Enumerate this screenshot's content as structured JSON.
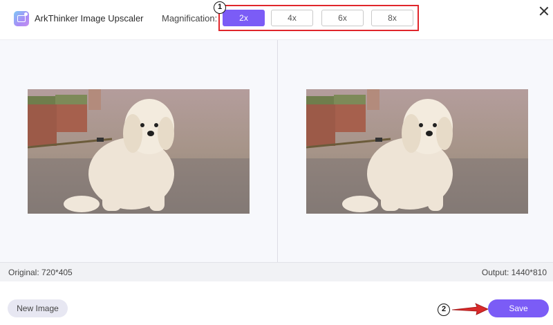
{
  "app": {
    "title": "ArkThinker Image Upscaler",
    "logo_icon": "image-upscaler-logo-icon"
  },
  "magnification": {
    "label": "Magnification:",
    "options": [
      {
        "label": "2x",
        "selected": true
      },
      {
        "label": "4x",
        "selected": false
      },
      {
        "label": "6x",
        "selected": false
      },
      {
        "label": "8x",
        "selected": false
      }
    ]
  },
  "annotations": {
    "step1": "1",
    "step2": "2"
  },
  "footer": {
    "original": "Original: 720*405",
    "output": "Output: 1440*810",
    "new_image": "New Image",
    "save": "Save"
  },
  "colors": {
    "accent": "#7b5cf6",
    "highlight": "#e0262b"
  }
}
